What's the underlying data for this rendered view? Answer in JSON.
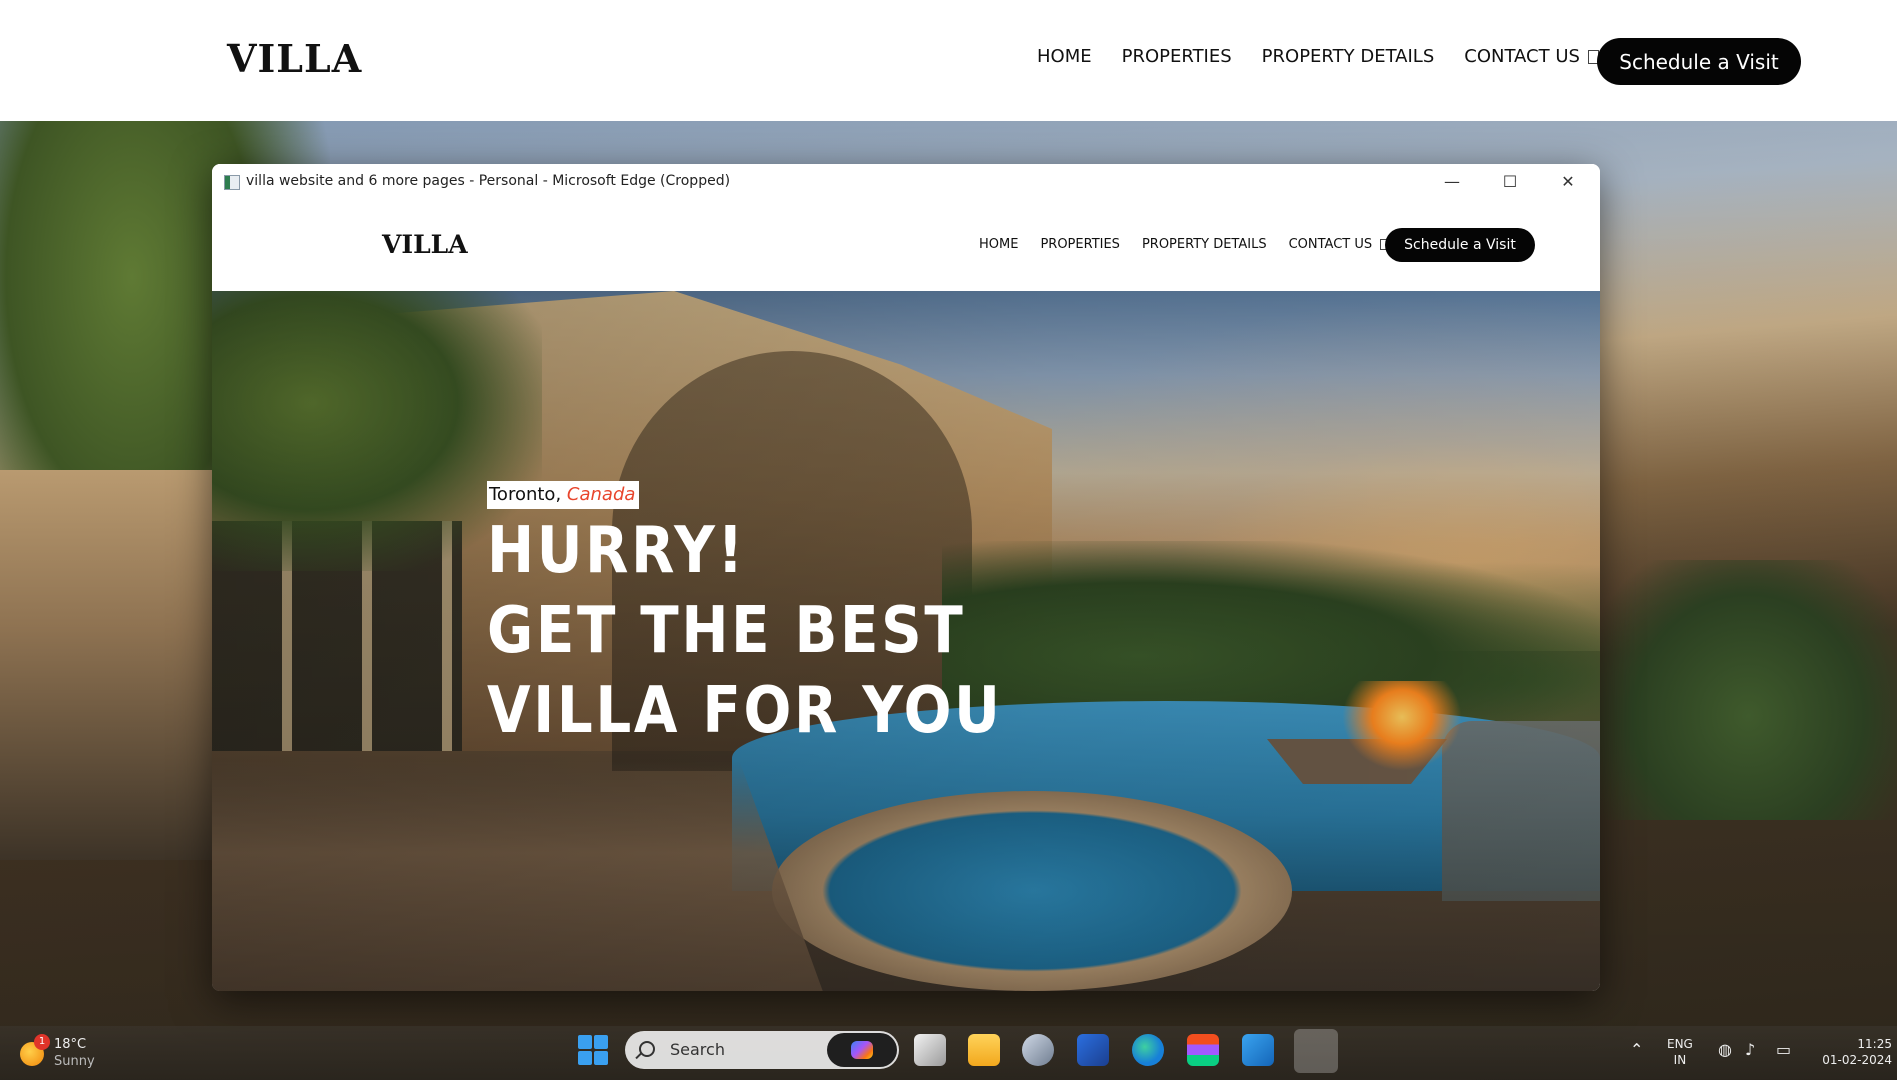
{
  "background_site": {
    "logo": "VILLA",
    "nav": [
      "HOME",
      "PROPERTIES",
      "PROPERTY DETAILS",
      "CONTACT US"
    ],
    "cta": "Schedule a Visit"
  },
  "window": {
    "title": "villa website and 6 more pages - Personal - Microsoft Edge (Cropped)",
    "controls": {
      "minimize": "—",
      "maximize": "☐",
      "close": "✕"
    }
  },
  "site": {
    "logo": "VILLA",
    "nav": [
      "HOME",
      "PROPERTIES",
      "PROPERTY DETAILS",
      "CONTACT US"
    ],
    "cta": "Schedule a Visit",
    "hero": {
      "city": "Toronto,",
      "country": "Canada",
      "headline": [
        "HURRY!",
        "GET THE BEST",
        "VILLA FOR YOU"
      ]
    }
  },
  "taskbar": {
    "weather": {
      "temp": "18°C",
      "condition": "Sunny",
      "badge": "1"
    },
    "search_label": "Search",
    "apps": [
      "task-view",
      "file-explorer",
      "camera",
      "store",
      "edge",
      "figma",
      "vscode",
      "active-app"
    ],
    "tray": {
      "lang": "ENG",
      "region": "IN",
      "time": "11:25",
      "date": "01-02-2024"
    }
  }
}
